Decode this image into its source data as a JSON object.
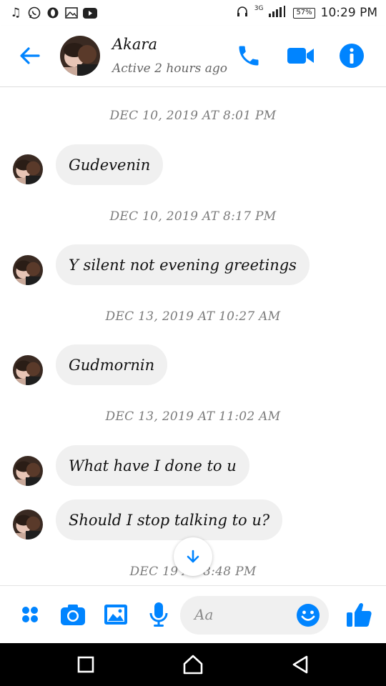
{
  "status_bar": {
    "left_icons": [
      "music-icon",
      "whatsapp-icon",
      "opera-icon",
      "gallery-icon",
      "youtube-icon"
    ],
    "network": "3G",
    "battery": "57%",
    "time": "10:29 PM"
  },
  "header": {
    "name": "Akara",
    "status": "Active 2 hours ago"
  },
  "messages": [
    {
      "timestamp": "DEC 10, 2019 AT 8:01 PM",
      "text": "Gudevenin"
    },
    {
      "timestamp": "DEC 10, 2019 AT 8:17 PM",
      "text": "Y silent not evening greetings"
    },
    {
      "timestamp": "DEC 13, 2019 AT 10:27 AM",
      "text": "Gudmornin"
    },
    {
      "timestamp": "DEC 13, 2019 AT 11:02 AM",
      "text": "What have I done to u"
    },
    {
      "timestamp": "",
      "text": "Should I stop talking to u?"
    },
    {
      "timestamp": "DEC 19 AT 8:48 PM",
      "text": ""
    }
  ],
  "composer": {
    "placeholder": "Aa"
  },
  "colors": {
    "accent": "#0084ff",
    "bubble": "#f0f0f0",
    "timestamp": "#7b7b7b",
    "navbar": "#000000"
  }
}
